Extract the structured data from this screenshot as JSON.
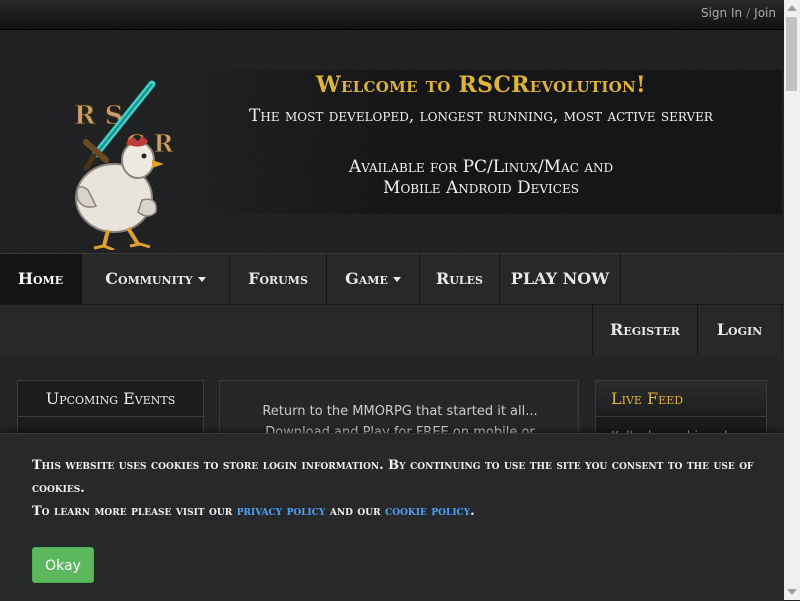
{
  "topbar": {
    "sign_in": "Sign In",
    "separator": "/",
    "join": "Join"
  },
  "header": {
    "welcome": "Welcome to RSCRevolution!",
    "tagline": "The most developed, longest running, most active server",
    "available_line1": "Available for PC/Linux/Mac and",
    "available_line2": "Mobile Android Devices",
    "logo_letters": "RSCR"
  },
  "nav": {
    "items": [
      {
        "label": "Home",
        "active": true
      },
      {
        "label": "Community",
        "dropdown": true
      },
      {
        "label": "Forums"
      },
      {
        "label": "Game",
        "dropdown": true
      },
      {
        "label": "Rules"
      },
      {
        "label": "PLAY NOW"
      }
    ],
    "right_items": [
      {
        "label": "Register"
      },
      {
        "label": "Login"
      }
    ]
  },
  "content": {
    "events_title": "Upcoming Events",
    "center_line1": "Return to the MMORPG that started it all...",
    "center_line2": "Download and Play for FREE on mobile or",
    "feed_title": "Live Feed",
    "feed_text": "Kall... has achieved..."
  },
  "cookie": {
    "line1": "This website uses cookies to store login information. By continuing to use the site you consent to the use of cookies.",
    "line2_prefix": "To learn more please visit our",
    "privacy_link": "privacy policy",
    "line2_mid": "and our",
    "cookie_link": "cookie policy",
    "line2_suffix": ".",
    "okay_label": "Okay"
  },
  "colors": {
    "accent_gold": "#e0b33a",
    "link_blue": "#4da3ff",
    "okay_green": "#5cb85c"
  }
}
